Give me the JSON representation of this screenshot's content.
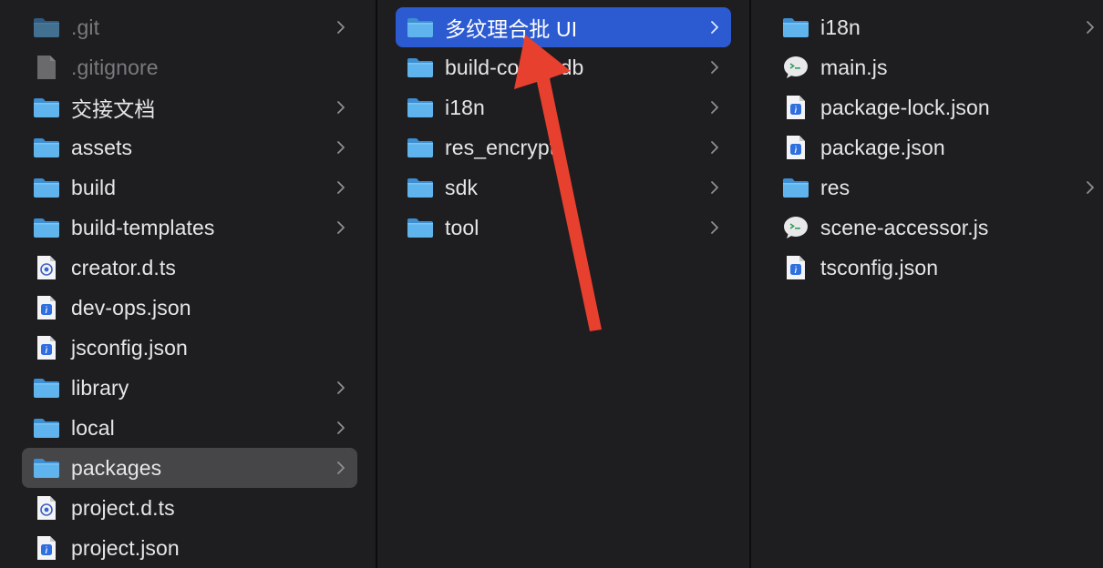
{
  "columns": [
    {
      "items": [
        {
          "label": ".git",
          "icon": "folder-icon",
          "chevron": true,
          "state": "dim"
        },
        {
          "label": ".gitignore",
          "icon": "file-icon",
          "chevron": false,
          "state": "dim"
        },
        {
          "label": "交接文档",
          "icon": "folder-icon",
          "chevron": true,
          "state": ""
        },
        {
          "label": "assets",
          "icon": "folder-icon",
          "chevron": true,
          "state": ""
        },
        {
          "label": "build",
          "icon": "folder-icon",
          "chevron": true,
          "state": ""
        },
        {
          "label": "build-templates",
          "icon": "folder-icon",
          "chevron": true,
          "state": ""
        },
        {
          "label": "creator.d.ts",
          "icon": "ts-file-icon",
          "chevron": false,
          "state": ""
        },
        {
          "label": "dev-ops.json",
          "icon": "json-file-icon",
          "chevron": false,
          "state": ""
        },
        {
          "label": "jsconfig.json",
          "icon": "json-file-icon",
          "chevron": false,
          "state": ""
        },
        {
          "label": "library",
          "icon": "folder-icon",
          "chevron": true,
          "state": ""
        },
        {
          "label": "local",
          "icon": "folder-icon",
          "chevron": true,
          "state": ""
        },
        {
          "label": "packages",
          "icon": "folder-icon",
          "chevron": true,
          "state": "selected-inactive"
        },
        {
          "label": "project.d.ts",
          "icon": "ts-file-icon",
          "chevron": false,
          "state": ""
        },
        {
          "label": "project.json",
          "icon": "json-file-icon",
          "chevron": false,
          "state": ""
        }
      ]
    },
    {
      "items": [
        {
          "label": "多纹理合批 UI",
          "icon": "folder-icon",
          "chevron": true,
          "state": "selected-active"
        },
        {
          "label": "build-config-db",
          "icon": "folder-icon",
          "chevron": true,
          "state": ""
        },
        {
          "label": "i18n",
          "icon": "folder-icon",
          "chevron": true,
          "state": ""
        },
        {
          "label": "res_encrypt",
          "icon": "folder-icon",
          "chevron": true,
          "state": ""
        },
        {
          "label": "sdk",
          "icon": "folder-icon",
          "chevron": true,
          "state": ""
        },
        {
          "label": "tool",
          "icon": "folder-icon",
          "chevron": true,
          "state": ""
        }
      ]
    },
    {
      "items": [
        {
          "label": "i18n",
          "icon": "folder-icon",
          "chevron": true,
          "state": ""
        },
        {
          "label": "main.js",
          "icon": "wechat-js-file-icon",
          "chevron": false,
          "state": ""
        },
        {
          "label": "package-lock.json",
          "icon": "json-file-icon",
          "chevron": false,
          "state": ""
        },
        {
          "label": "package.json",
          "icon": "json-file-icon",
          "chevron": false,
          "state": ""
        },
        {
          "label": "res",
          "icon": "folder-icon",
          "chevron": true,
          "state": ""
        },
        {
          "label": "scene-accessor.js",
          "icon": "wechat-js-file-icon",
          "chevron": false,
          "state": ""
        },
        {
          "label": "tsconfig.json",
          "icon": "json-file-icon",
          "chevron": false,
          "state": ""
        }
      ]
    }
  ],
  "colors": {
    "background": "#1e1d1f",
    "selection_active": "#2c5ad1",
    "selection_inactive": "#464648",
    "folder_blue": "#5fb4ee",
    "annotation_arrow": "#e8402f"
  }
}
